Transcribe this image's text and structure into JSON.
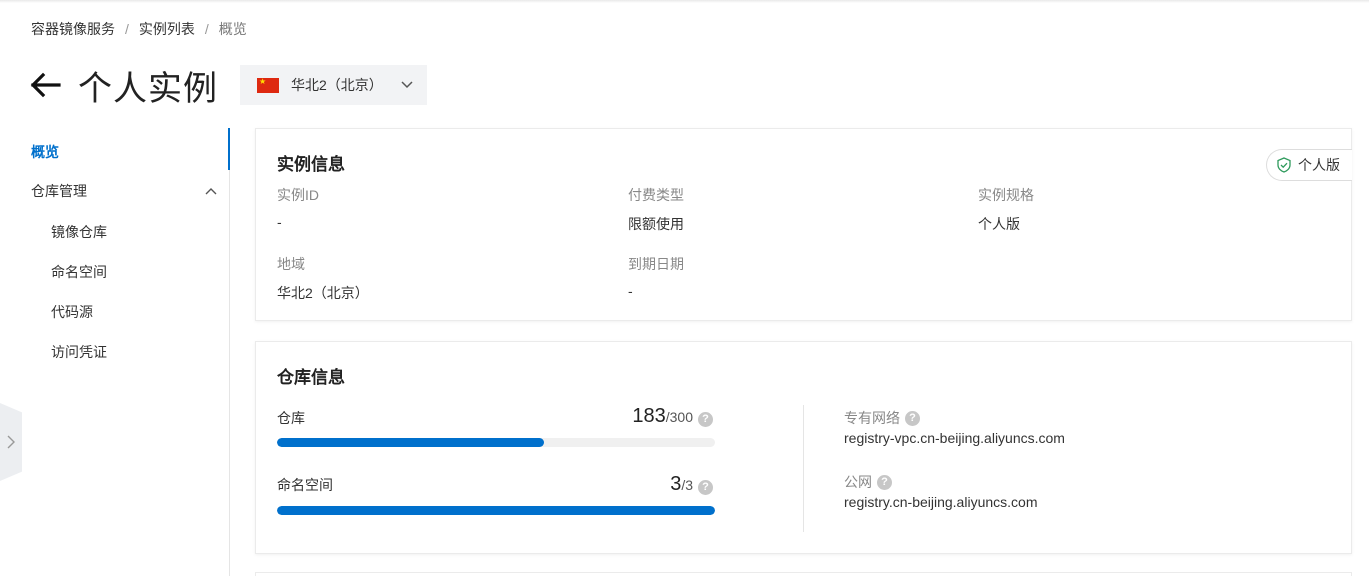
{
  "breadcrumb": {
    "items": [
      "容器镜像服务",
      "实例列表",
      "概览"
    ],
    "separator": "/"
  },
  "header": {
    "title": "个人实例",
    "region": "华北2（北京）"
  },
  "sidebar": {
    "overview": "概览",
    "repo_group": "仓库管理",
    "sub_items": [
      "镜像仓库",
      "命名空间",
      "代码源",
      "访问凭证"
    ]
  },
  "instance_info": {
    "title": "实例信息",
    "badge": "个人版",
    "fields": {
      "instance_id": {
        "label": "实例ID",
        "value": "-"
      },
      "billing_type": {
        "label": "付费类型",
        "value": "限额使用"
      },
      "spec": {
        "label": "实例规格",
        "value": "个人版"
      },
      "region": {
        "label": "地域",
        "value": "华北2（北京）"
      },
      "expiry": {
        "label": "到期日期",
        "value": "-"
      }
    }
  },
  "repo_info": {
    "title": "仓库信息",
    "repositories": {
      "label": "仓库",
      "used": "183",
      "total": "/300",
      "fraction": 0.61
    },
    "namespaces": {
      "label": "命名空间",
      "used": "3",
      "total": "/3",
      "fraction": 1.0
    },
    "vpc": {
      "label": "专有网络",
      "value": "registry-vpc.cn-beijing.aliyuncs.com"
    },
    "public": {
      "label": "公网",
      "value": "registry.cn-beijing.aliyuncs.com"
    }
  },
  "colors": {
    "accent": "#0070cc",
    "flag_red": "#de2910",
    "flag_star": "#ffde00",
    "badge_green": "#2e9a5c"
  },
  "icons": {
    "back": "arrow-left-icon",
    "region_chevron": "chevron-down-icon",
    "group_chevron": "chevron-up-icon",
    "help": "question-icon",
    "badge": "shield-check-icon",
    "expand": "chevron-right-icon"
  }
}
